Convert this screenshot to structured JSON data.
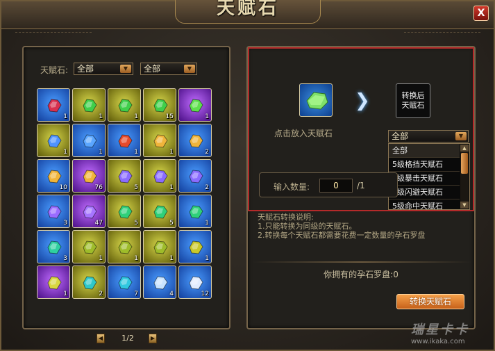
{
  "window": {
    "title": "天赋石",
    "close_label": "X"
  },
  "filter": {
    "label": "天赋石:",
    "select1_value": "全部",
    "select2_value": "全部"
  },
  "inventory": {
    "slots": [
      {
        "bg": "blue",
        "gem": "#d8304f",
        "count": "1"
      },
      {
        "bg": "gold",
        "gem": "#3fcf4a",
        "count": "1"
      },
      {
        "bg": "gold",
        "gem": "#3fcf4a",
        "count": "1"
      },
      {
        "bg": "gold",
        "gem": "#3fcf4a",
        "count": "15"
      },
      {
        "bg": "purple",
        "gem": "#5ee04c",
        "count": "1"
      },
      {
        "bg": "gold",
        "gem": "#4f93ff",
        "count": "1"
      },
      {
        "bg": "blue",
        "gem": "#5aa6ff",
        "count": "1"
      },
      {
        "bg": "blue",
        "gem": "#e64a2a",
        "count": "1"
      },
      {
        "bg": "gold",
        "gem": "#f0b43a",
        "count": "1"
      },
      {
        "bg": "blue",
        "gem": "#f0b43a",
        "count": "2"
      },
      {
        "bg": "blue",
        "gem": "#f0b43a",
        "count": "10"
      },
      {
        "bg": "purple",
        "gem": "#f0b43a",
        "count": "76"
      },
      {
        "bg": "gold",
        "gem": "#8a6cff",
        "count": "5"
      },
      {
        "bg": "gold",
        "gem": "#8a6cff",
        "count": "1"
      },
      {
        "bg": "blue",
        "gem": "#8a6cff",
        "count": "2"
      },
      {
        "bg": "blue",
        "gem": "#9a6cff",
        "count": "3"
      },
      {
        "bg": "purple",
        "gem": "#a675ff",
        "count": "47"
      },
      {
        "bg": "gold",
        "gem": "#2fd07a",
        "count": "5"
      },
      {
        "bg": "gold",
        "gem": "#2fd07a",
        "count": "5"
      },
      {
        "bg": "blue",
        "gem": "#2fd07a",
        "count": "1"
      },
      {
        "bg": "blue",
        "gem": "#2fd0a0",
        "count": "3"
      },
      {
        "bg": "gold",
        "gem": "#9ebc2a",
        "count": "1"
      },
      {
        "bg": "gold",
        "gem": "#9ebc2a",
        "count": "1"
      },
      {
        "bg": "gold",
        "gem": "#9ebc2a",
        "count": "1"
      },
      {
        "bg": "blue",
        "gem": "#c8c82a",
        "count": "1"
      },
      {
        "bg": "purple",
        "gem": "#d8d840",
        "count": "1"
      },
      {
        "bg": "gold",
        "gem": "#30c8c8",
        "count": "2"
      },
      {
        "bg": "blue",
        "gem": "#30c8e0",
        "count": "7"
      },
      {
        "bg": "blue",
        "gem": "#c8e4ff",
        "count": "4"
      },
      {
        "bg": "blue",
        "gem": "#e0ecff",
        "count": "12"
      }
    ]
  },
  "pager": {
    "text": "1/2"
  },
  "converter": {
    "target_label_line1": "转换后",
    "target_label_line2": "天赋石",
    "place_hint": "点击放入天赋石",
    "target_select_value": "全部",
    "dropdown_items": [
      "全部",
      "5级格挡天赋石",
      "5级暴击天赋石",
      "5级闪避天赋石",
      "5级命中天赋石"
    ],
    "qty_label": "输入数量:",
    "qty_value": "0",
    "qty_max": "/1",
    "desc_title": "天赋石转换说明:",
    "desc_line1": "1.只能转换为同级的天赋石。",
    "desc_line2": "2.转换每个天赋石都需要花费一定数量的孕石罗盘",
    "compass_text": "你拥有的孕石罗盘:0",
    "convert_button": "转换天赋石"
  },
  "watermark": {
    "main": "瑞星卡卡",
    "url": "www.ikaka.com"
  },
  "colors": {
    "slot_blue": "#1f5fc8",
    "slot_gold": "#9a9a1a",
    "slot_purple": "#8a2ac8",
    "accent_border": "#b52a2a",
    "button": "#f09040"
  }
}
